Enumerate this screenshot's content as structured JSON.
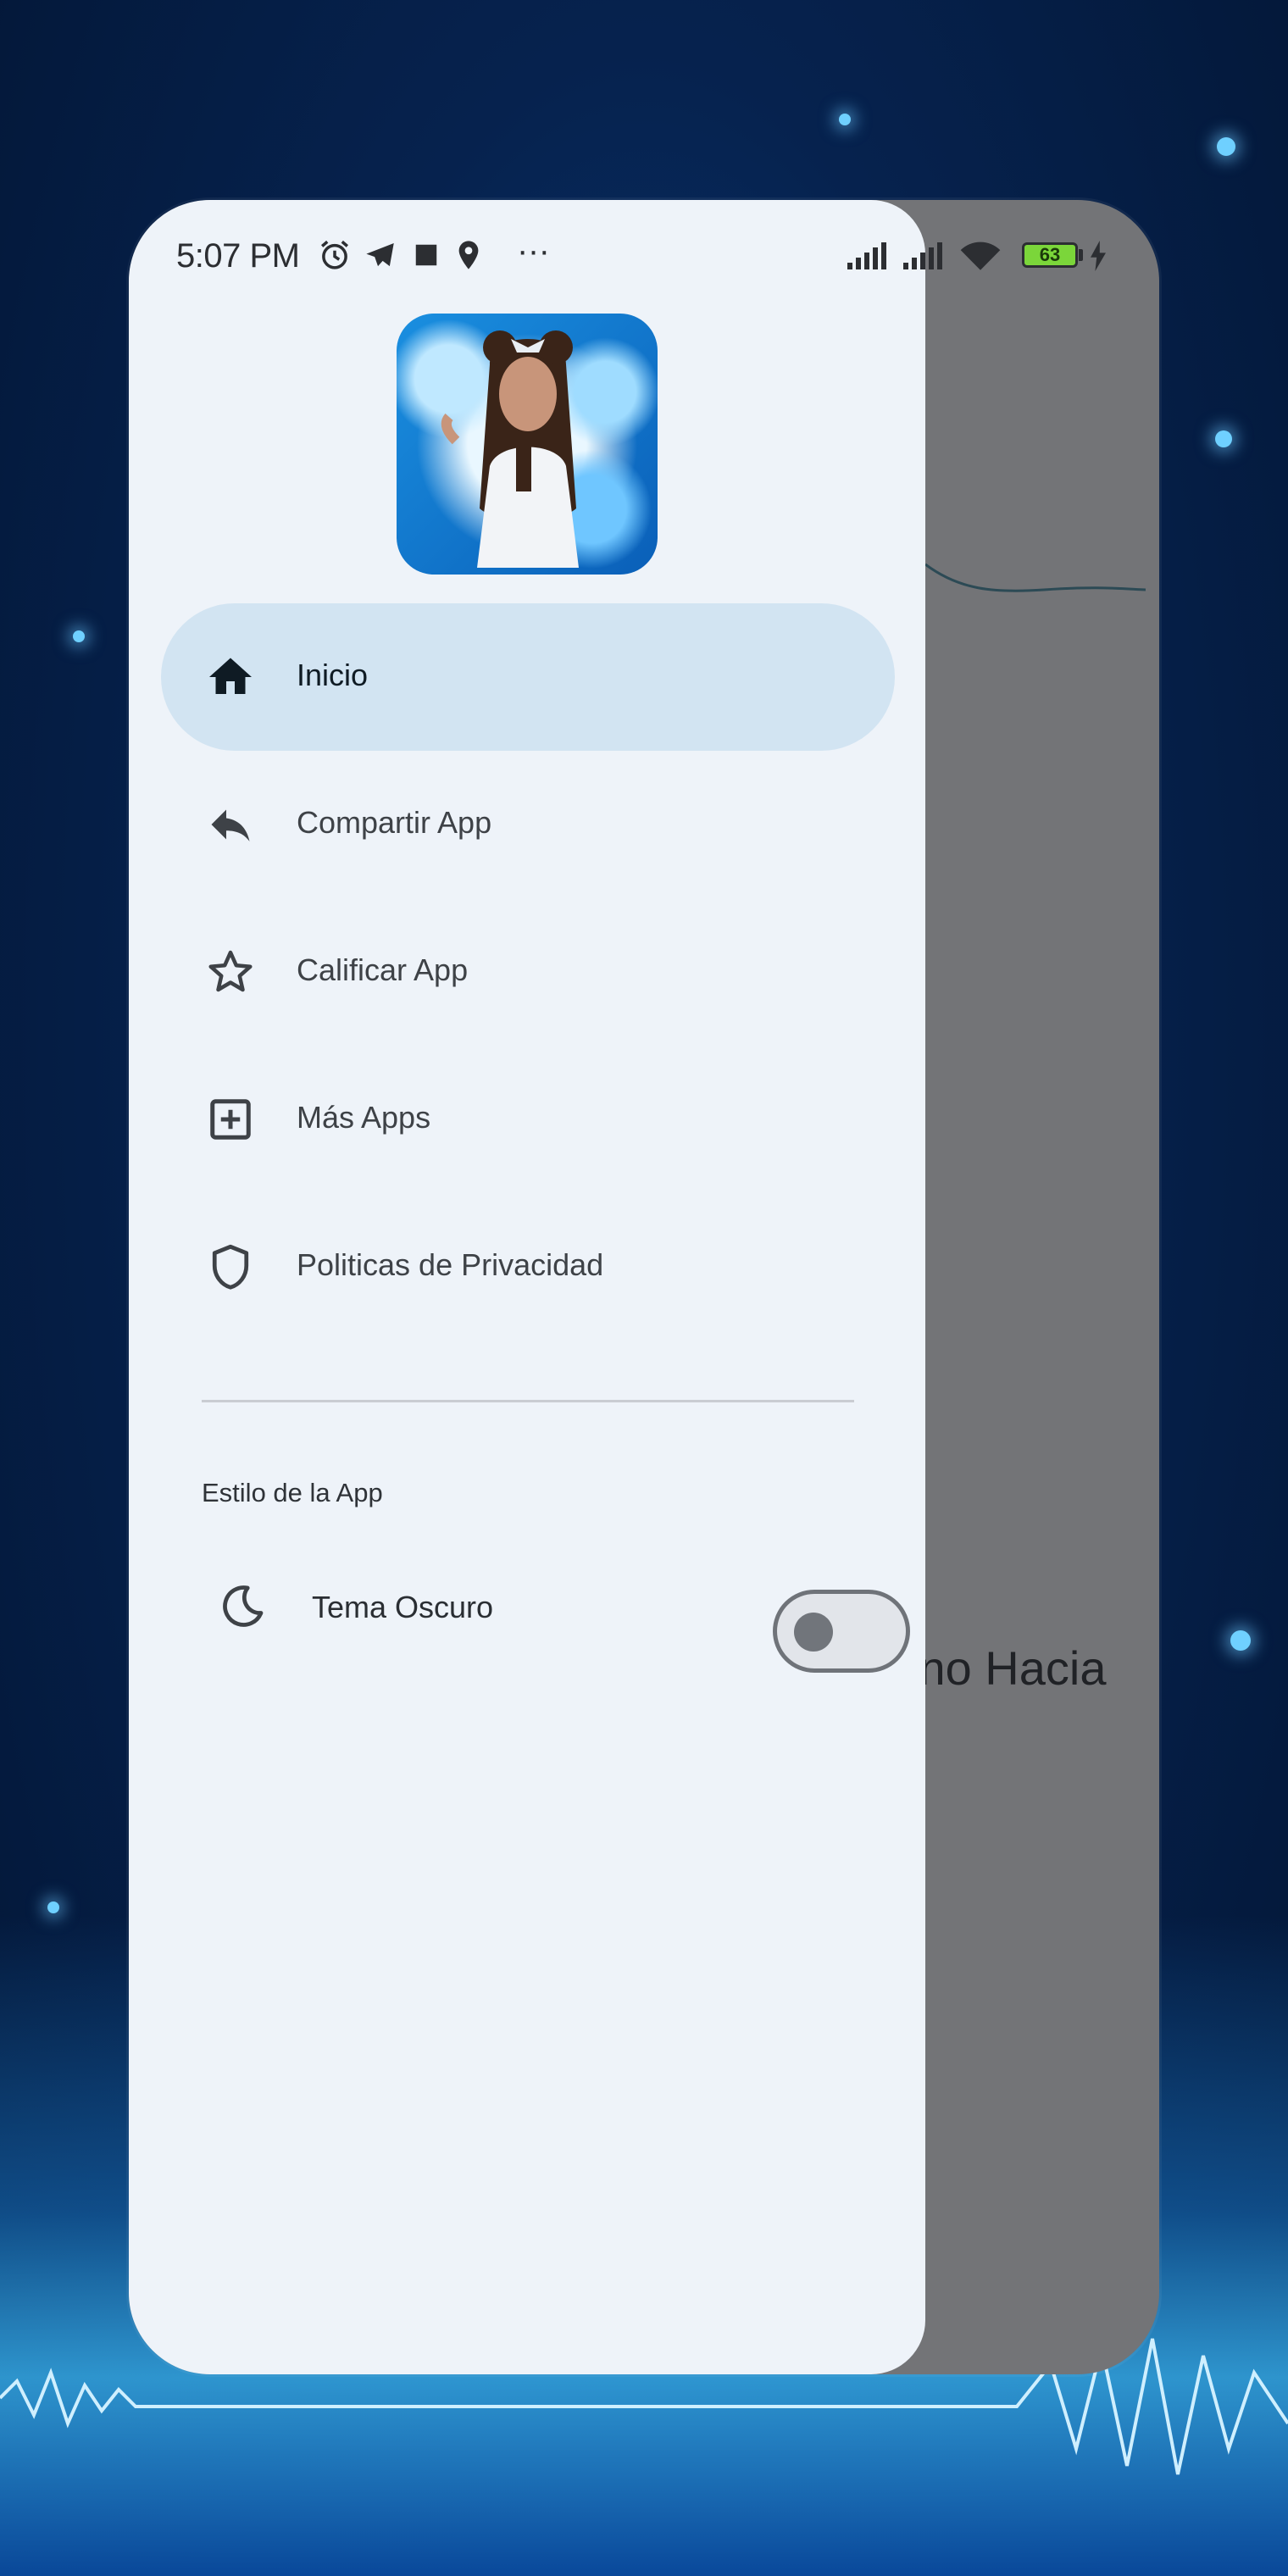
{
  "status_bar": {
    "time": "5:07 PM",
    "more_indicator": "···",
    "battery_level": "63",
    "icons": [
      "alarm-icon",
      "telegram-icon",
      "square-icon",
      "location-icon",
      "signal-icon",
      "signal-icon",
      "wifi-icon",
      "battery-icon",
      "charging-icon"
    ]
  },
  "drawer": {
    "menu_items": [
      {
        "label": "Inicio",
        "icon": "home-icon",
        "active": true
      },
      {
        "label": "Compartir App",
        "icon": "share-icon",
        "active": false
      },
      {
        "label": "Calificar App",
        "icon": "star-icon",
        "active": false
      },
      {
        "label": "Más Apps",
        "icon": "add-box-icon",
        "active": false
      },
      {
        "label": "Politicas de Privacidad",
        "icon": "shield-icon",
        "active": false
      }
    ],
    "section_title": "Estilo de la App",
    "dark_theme": {
      "label": "Tema Oscuro",
      "icon": "moon-icon",
      "enabled": false
    }
  },
  "underlay": {
    "partial_text": "ino Hacia"
  },
  "colors": {
    "drawer_background": "#eef3f9",
    "active_item_background": "#d2e4f2",
    "scrim": "#737477",
    "icon_color": "#3e4247"
  }
}
